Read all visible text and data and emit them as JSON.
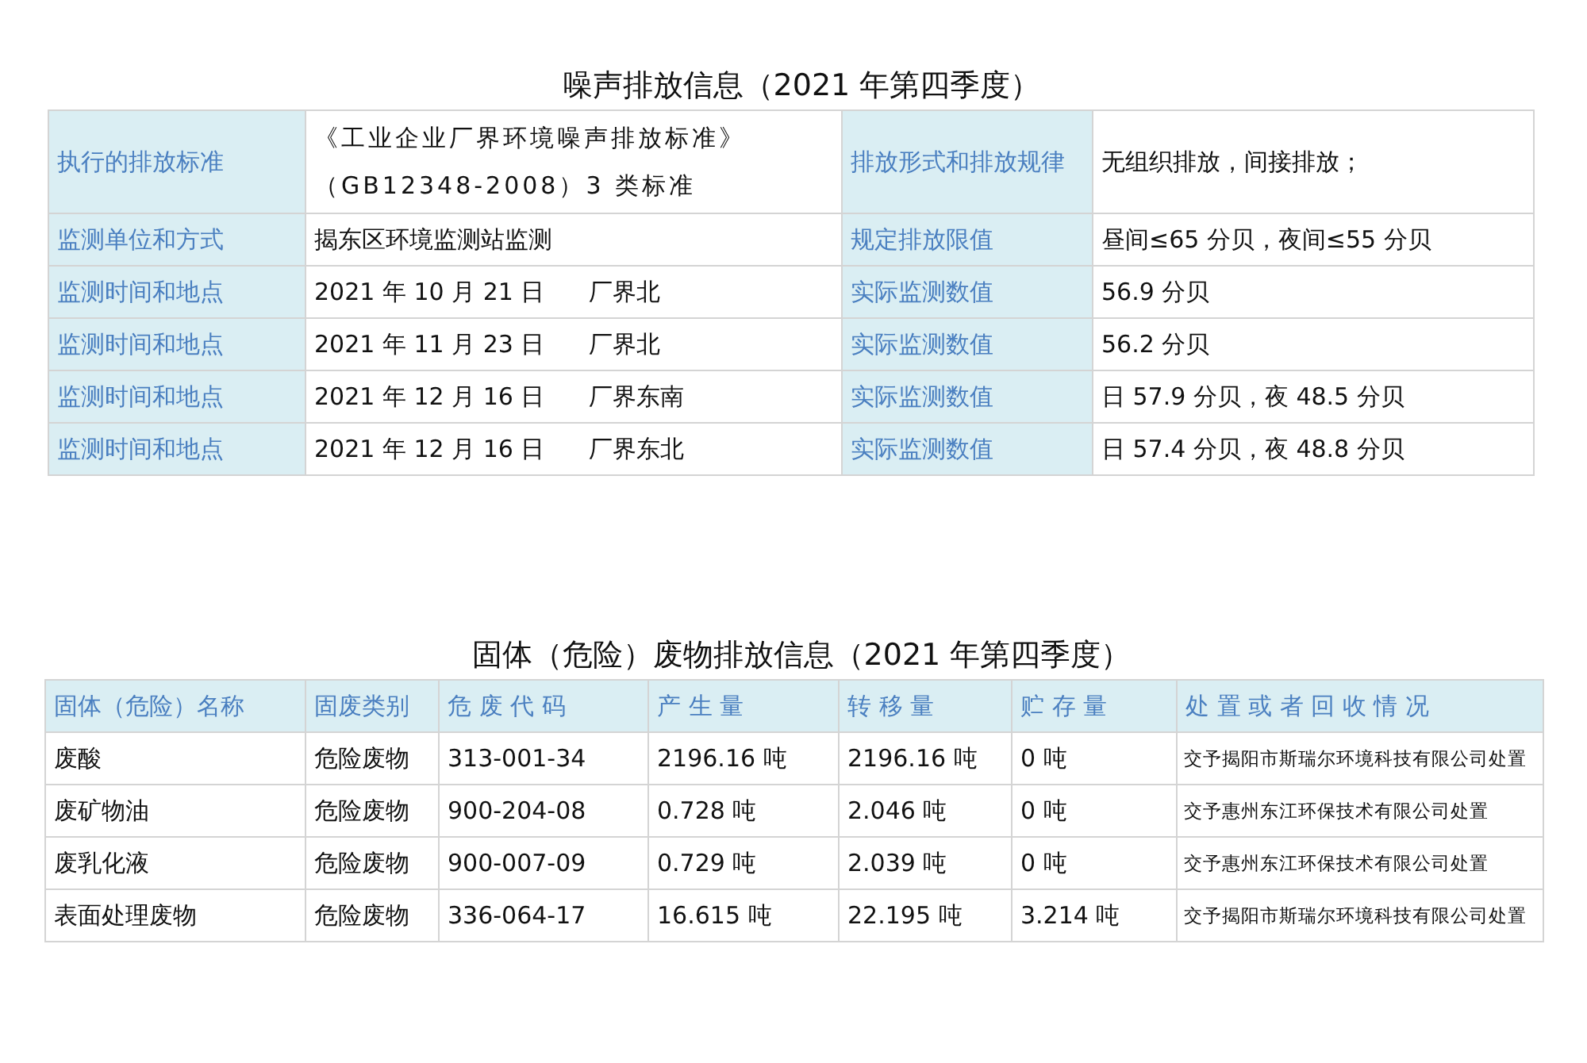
{
  "noise": {
    "title": "噪声排放信息（2021 年第四季度）",
    "rows": [
      {
        "label_1": "执行的排放标准",
        "value_1": "《工业企业厂界环境噪声排放标准》（GB12348-2008）3 类标准",
        "label_2": "排放形式和排放规律",
        "value_2": "无组织排放，间接排放；"
      },
      {
        "label_1": "监测单位和方式",
        "value_1": "揭东区环境监测站监测",
        "label_2": "规定排放限值",
        "value_2": "昼间≤65 分贝，夜间≤55 分贝"
      },
      {
        "label_1": "监测时间和地点",
        "value_1": "2021 年 10 月 21 日",
        "place": "厂界北",
        "label_2": "实际监测数值",
        "value_2": "56.9 分贝"
      },
      {
        "label_1": "监测时间和地点",
        "value_1": "2021 年 11 月 23 日",
        "place": "厂界北",
        "label_2": "实际监测数值",
        "value_2": "56.2 分贝"
      },
      {
        "label_1": "监测时间和地点",
        "value_1": "2021 年 12 月 16 日",
        "place": "厂界东南",
        "label_2": "实际监测数值",
        "value_2": "日 57.9 分贝，夜 48.5 分贝"
      },
      {
        "label_1": "监测时间和地点",
        "value_1": "2021 年 12 月 16 日",
        "place": "厂界东北",
        "label_2": "实际监测数值",
        "value_2": "日 57.4 分贝，夜 48.8 分贝"
      }
    ]
  },
  "waste": {
    "title": "固体（危险）废物排放信息（2021 年第四季度）",
    "columns": [
      "固体（危险）名称",
      "固废类别",
      "危 废 代 码",
      "产 生 量",
      "转 移 量",
      "贮 存 量",
      "处 置 或 者 回 收 情 况"
    ],
    "rows": [
      [
        "废酸",
        "危险废物",
        "313-001-34",
        "2196.16 吨",
        "2196.16 吨",
        "0 吨",
        "交予揭阳市斯瑞尔环境科技有限公司处置"
      ],
      [
        "废矿物油",
        "危险废物",
        "900-204-08",
        "0.728 吨",
        "2.046 吨",
        "0 吨",
        "交予惠州东江环保技术有限公司处置"
      ],
      [
        "废乳化液",
        "危险废物",
        "900-007-09",
        "0.729 吨",
        "2.039 吨",
        "0 吨",
        "交予惠州东江环保技术有限公司处置"
      ],
      [
        "表面处理废物",
        "危险废物",
        "336-064-17",
        "16.615 吨",
        "22.195 吨",
        "3.214 吨",
        "交予揭阳市斯瑞尔环境科技有限公司处置"
      ]
    ]
  }
}
